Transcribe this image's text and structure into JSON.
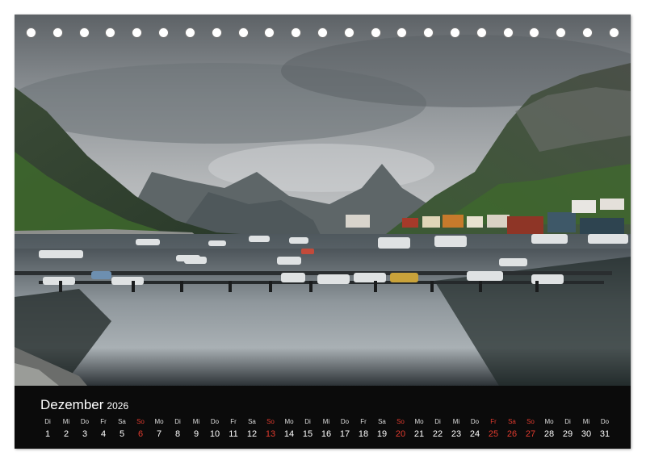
{
  "calendar": {
    "month": "Dezember",
    "year": "2026",
    "days": [
      {
        "dow": "Di",
        "num": "1",
        "red": false
      },
      {
        "dow": "Mi",
        "num": "2",
        "red": false
      },
      {
        "dow": "Do",
        "num": "3",
        "red": false
      },
      {
        "dow": "Fr",
        "num": "4",
        "red": false
      },
      {
        "dow": "Sa",
        "num": "5",
        "red": false
      },
      {
        "dow": "So",
        "num": "6",
        "red": true
      },
      {
        "dow": "Mo",
        "num": "7",
        "red": false
      },
      {
        "dow": "Di",
        "num": "8",
        "red": false
      },
      {
        "dow": "Mi",
        "num": "9",
        "red": false
      },
      {
        "dow": "Do",
        "num": "10",
        "red": false
      },
      {
        "dow": "Fr",
        "num": "11",
        "red": false
      },
      {
        "dow": "Sa",
        "num": "12",
        "red": false
      },
      {
        "dow": "So",
        "num": "13",
        "red": true
      },
      {
        "dow": "Mo",
        "num": "14",
        "red": false
      },
      {
        "dow": "Di",
        "num": "15",
        "red": false
      },
      {
        "dow": "Mi",
        "num": "16",
        "red": false
      },
      {
        "dow": "Do",
        "num": "17",
        "red": false
      },
      {
        "dow": "Fr",
        "num": "18",
        "red": false
      },
      {
        "dow": "Sa",
        "num": "19",
        "red": false
      },
      {
        "dow": "So",
        "num": "20",
        "red": true
      },
      {
        "dow": "Mo",
        "num": "21",
        "red": false
      },
      {
        "dow": "Di",
        "num": "22",
        "red": false
      },
      {
        "dow": "Mi",
        "num": "23",
        "red": false
      },
      {
        "dow": "Do",
        "num": "24",
        "red": false
      },
      {
        "dow": "Fr",
        "num": "25",
        "red": true
      },
      {
        "dow": "Sa",
        "num": "26",
        "red": true
      },
      {
        "dow": "So",
        "num": "27",
        "red": true
      },
      {
        "dow": "Mo",
        "num": "28",
        "red": false
      },
      {
        "dow": "Di",
        "num": "29",
        "red": false
      },
      {
        "dow": "Mi",
        "num": "30",
        "red": false
      },
      {
        "dow": "Do",
        "num": "31",
        "red": false
      }
    ]
  },
  "colors": {
    "holiday": "#e23b2e",
    "band": "#0b0b0b"
  },
  "binding_holes": 23
}
